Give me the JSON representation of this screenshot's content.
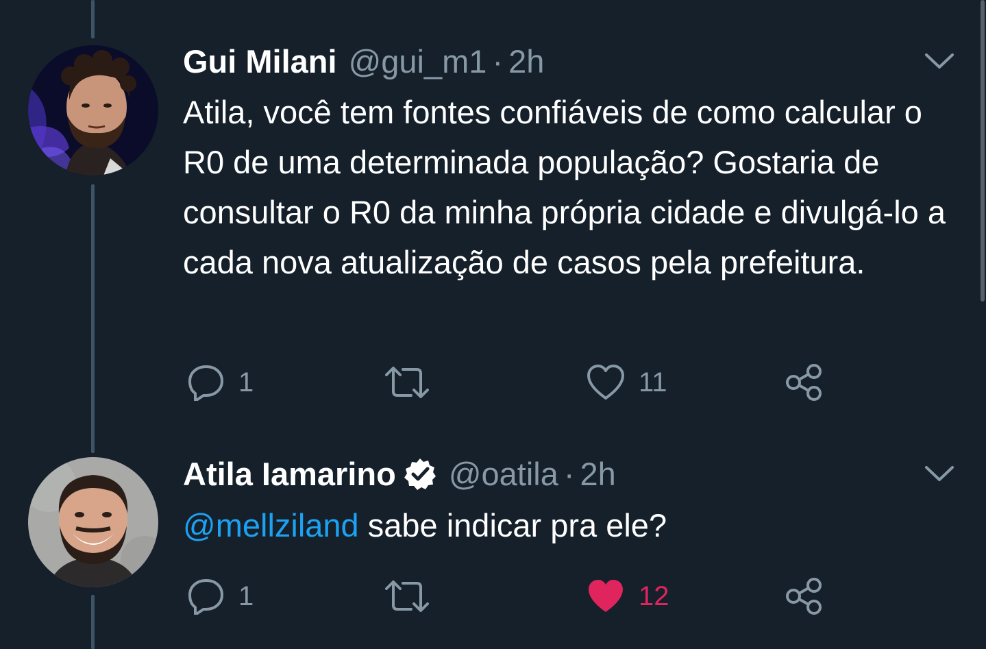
{
  "tweets": [
    {
      "display_name": "Gui Milani",
      "handle": "@gui_m1",
      "separator": "·",
      "time": "2h",
      "verified": false,
      "text": "Atila, você tem fontes confiáveis de como calcular o R0 de uma determinada população? Gostaria de consultar o R0 da minha própria cidade e divulgá-lo a cada nova atualização de casos pela prefeitura.",
      "replies": "1",
      "retweets": "",
      "likes": "11",
      "liked": false
    },
    {
      "display_name": "Atila Iamarino",
      "handle": "@oatila",
      "separator": "·",
      "time": "2h",
      "verified": true,
      "mention": "@mellziland",
      "text": " sabe indicar pra ele?",
      "replies": "1",
      "retweets": "",
      "likes": "12",
      "liked": true
    }
  ],
  "colors": {
    "background": "#15202b",
    "secondary_text": "#8899a6",
    "link": "#1da1f2",
    "like_active": "#e0245e",
    "thread_line": "#3d5466"
  },
  "icons": [
    "chevron-down-icon",
    "verified-badge-icon",
    "reply-icon",
    "retweet-icon",
    "heart-icon",
    "share-icon"
  ]
}
